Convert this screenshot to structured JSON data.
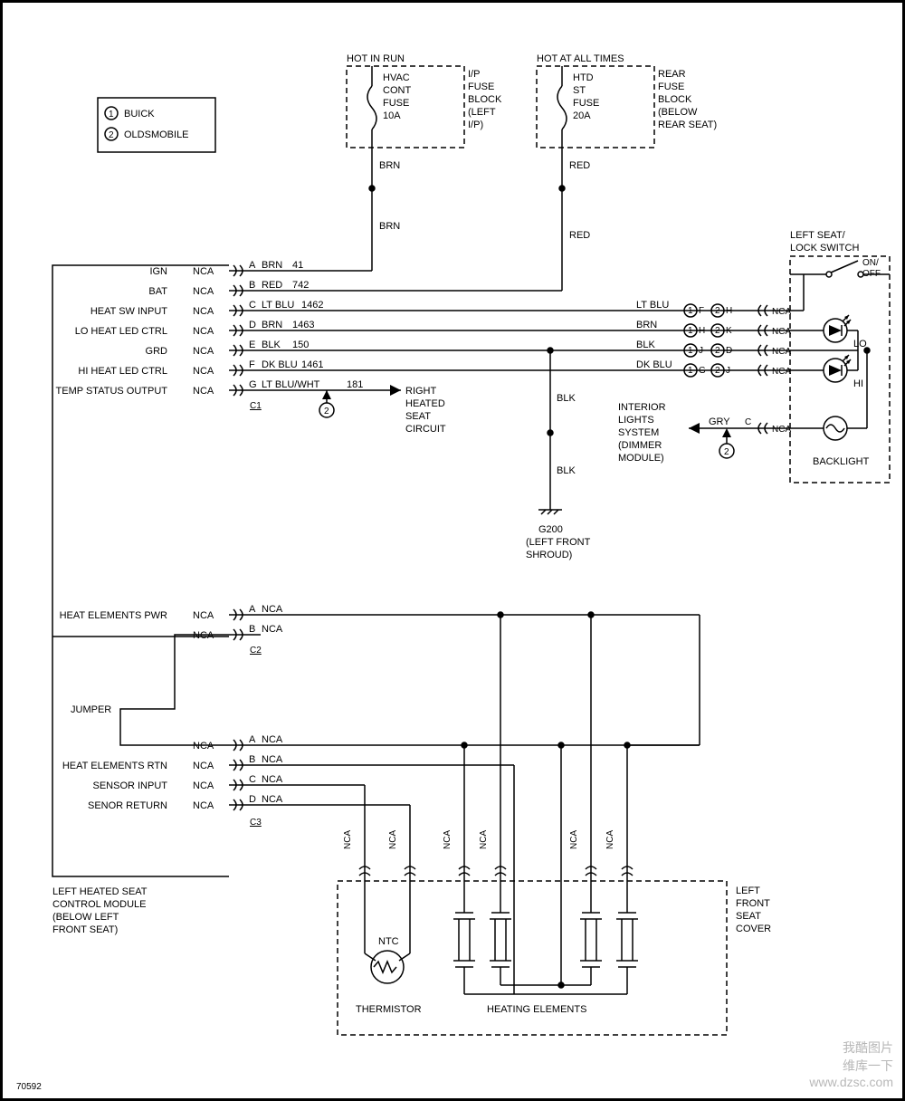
{
  "legend": {
    "item1": "BUICK",
    "item2": "OLDSMOBILE"
  },
  "fuses": {
    "left": {
      "title": "HOT IN RUN",
      "lines": [
        "HVAC",
        "CONT",
        "FUSE",
        "10A"
      ],
      "side": [
        "I/P",
        "FUSE",
        "BLOCK",
        "(LEFT",
        "I/P)"
      ],
      "wire": "BRN"
    },
    "right": {
      "title": "HOT AT ALL TIMES",
      "lines": [
        "HTD",
        "ST",
        "FUSE",
        "20A"
      ],
      "side": [
        "REAR",
        "FUSE",
        "BLOCK",
        "(BELOW",
        "REAR SEAT)"
      ],
      "wire": "RED"
    }
  },
  "module": {
    "signals_c1": [
      {
        "name": "IGN",
        "pin": "A",
        "wire": "BRN",
        "num": "41"
      },
      {
        "name": "BAT",
        "pin": "B",
        "wire": "RED",
        "num": "742"
      },
      {
        "name": "HEAT SW INPUT",
        "pin": "C",
        "wire": "LT BLU",
        "num": "1462"
      },
      {
        "name": "LO HEAT LED CTRL",
        "pin": "D",
        "wire": "BRN",
        "num": "1463"
      },
      {
        "name": "GRD",
        "pin": "E",
        "wire": "BLK",
        "num": "150"
      },
      {
        "name": "HI HEAT LED CTRL",
        "pin": "F",
        "wire": "DK BLU",
        "num": "1461"
      },
      {
        "name": "TEMP STATUS OUTPUT",
        "pin": "G",
        "wire": "LT BLU/WHT",
        "num": "181"
      }
    ],
    "conn1": "C1",
    "signals_c2": [
      {
        "name": "HEAT ELEMENTS PWR",
        "pin": "A",
        "wire": "NCA"
      },
      {
        "name": "",
        "pin": "B",
        "wire": "NCA"
      }
    ],
    "conn2": "C2",
    "jumper": "JUMPER",
    "signals_c3": [
      {
        "name": "",
        "pin": "A",
        "wire": "NCA"
      },
      {
        "name": "HEAT ELEMENTS RTN",
        "pin": "B",
        "wire": "NCA"
      },
      {
        "name": "SENSOR INPUT",
        "pin": "C",
        "wire": "NCA"
      },
      {
        "name": "SENOR RETURN",
        "pin": "D",
        "wire": "NCA"
      }
    ],
    "conn3": "C3",
    "nca": "NCA",
    "label": [
      "LEFT HEATED SEAT",
      "CONTROL MODULE",
      "(BELOW LEFT",
      "FRONT SEAT)"
    ]
  },
  "right_seat_circuit": [
    "RIGHT",
    "HEATED",
    "SEAT",
    "CIRCUIT"
  ],
  "ground": {
    "wire": "BLK",
    "label": [
      "G200",
      "(LEFT FRONT",
      "SHROUD)"
    ]
  },
  "interior_lights": [
    "INTERIOR",
    "LIGHTS",
    "SYSTEM",
    "(DIMMER",
    "MODULE)"
  ],
  "gry_wire": "GRY",
  "switch": {
    "title": [
      "LEFT SEAT/",
      "LOCK SWITCH"
    ],
    "onoff": [
      "ON/",
      "OFF"
    ],
    "lo": "LO",
    "hi": "HI",
    "backlight": "BACKLIGHT",
    "conn_left": [
      {
        "a": "F",
        "b": "H"
      },
      {
        "a": "H",
        "b": "K"
      },
      {
        "a": "J",
        "b": "D"
      },
      {
        "a": "G",
        "b": "J"
      }
    ],
    "c_pin": "C",
    "wires": [
      "LT BLU",
      "BRN",
      "BLK",
      "DK BLU"
    ]
  },
  "cover": {
    "label": [
      "LEFT",
      "FRONT",
      "SEAT",
      "COVER"
    ],
    "ntc": "NTC",
    "thermistor": "THERMISTOR",
    "heating": "HEATING ELEMENTS",
    "nca": "NCA"
  },
  "footer_id": "70592",
  "watermark": "我酷图片\n维库一下\nwww.dzsc.com"
}
